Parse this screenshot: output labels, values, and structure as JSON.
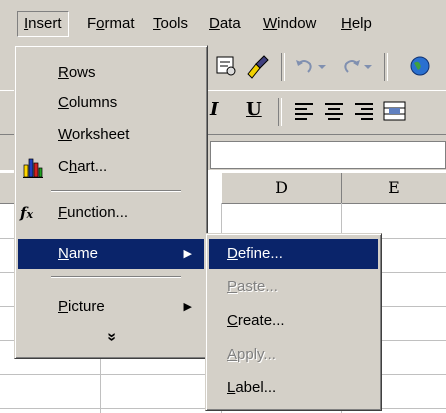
{
  "menubar": {
    "items": [
      {
        "pre": "",
        "u": "I",
        "post": "nsert"
      },
      {
        "pre": "F",
        "u": "o",
        "post": "rmat"
      },
      {
        "pre": "",
        "u": "T",
        "post": "ools"
      },
      {
        "pre": "",
        "u": "D",
        "post": "ata"
      },
      {
        "pre": "",
        "u": "W",
        "post": "indow"
      },
      {
        "pre": "",
        "u": "H",
        "post": "elp"
      }
    ]
  },
  "insert_menu": {
    "rows": {
      "pre": "",
      "u": "R",
      "post": "ows"
    },
    "columns": {
      "pre": "",
      "u": "C",
      "post": "olumns"
    },
    "worksheet": {
      "pre": "",
      "u": "W",
      "post": "orksheet"
    },
    "chart": {
      "pre": "C",
      "u": "h",
      "post": "art..."
    },
    "function": {
      "pre": "",
      "u": "F",
      "post": "unction..."
    },
    "name": {
      "pre": "",
      "u": "N",
      "post": "ame"
    },
    "picture": {
      "pre": "",
      "u": "P",
      "post": "icture"
    },
    "expand": "»"
  },
  "name_submenu": {
    "define": {
      "pre": "",
      "u": "D",
      "post": "efine..."
    },
    "paste": {
      "pre": "",
      "u": "P",
      "post": "aste..."
    },
    "create": {
      "pre": "",
      "u": "C",
      "post": "reate..."
    },
    "apply": {
      "pre": "",
      "u": "A",
      "post": "pply..."
    },
    "label": {
      "pre": "",
      "u": "L",
      "post": "abel..."
    }
  },
  "toolbar": {
    "underline_label": "U",
    "italic_label": "I"
  },
  "grid": {
    "col_d": "D",
    "col_e": "E"
  },
  "icons": {
    "function_glyph": "f",
    "function_glyph_x": "x",
    "submenu_arrow": "▶"
  },
  "colors": {
    "menu_bg": "#d4d0c8",
    "highlight": "#0a246a"
  }
}
